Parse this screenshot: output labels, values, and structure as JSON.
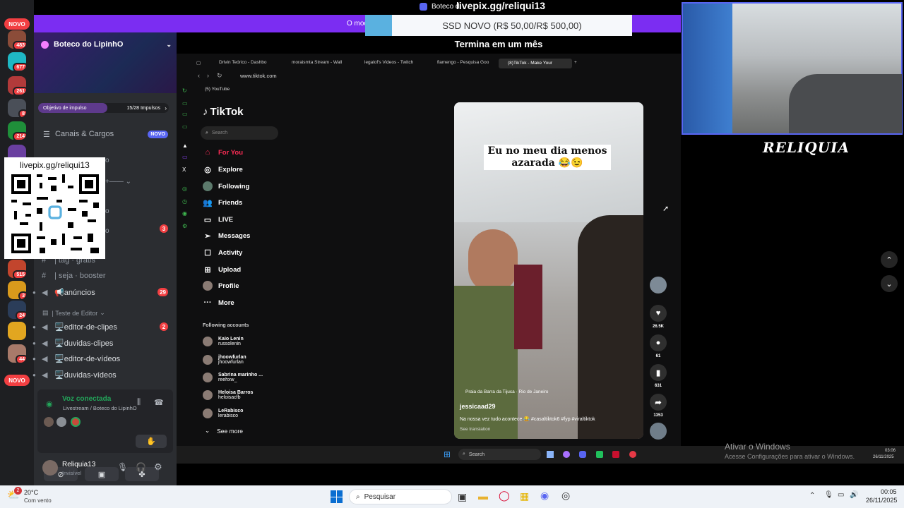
{
  "stream_title_top": "livepix.gg/reliqui13",
  "discord_overlay_title": "Boteco d",
  "promo": {
    "prefix": "O mod",
    "banner": "SSD NOVO (R$ 50,00/R$ 500,00)",
    "subtitle": "Termina em um mês"
  },
  "webcam_name": "RELIQUIA",
  "qr": {
    "label": "livepix.gg/reliqui13"
  },
  "discord": {
    "server_name": "Boteco do LipinhO",
    "boost_label": "Objetivo de impulso",
    "boost_count": "15/28 Impulsos",
    "canais_label": "Canais & Cargos",
    "canais_badge": "NOVO",
    "partial_1": "o",
    "partial_2": "o",
    "partial_3": "o",
    "badge_3": "3",
    "channels": [
      {
        "label": "| tag · grátis",
        "count": ""
      },
      {
        "label": "| seja · booster",
        "count": ""
      },
      {
        "label": "📢anúncios",
        "count": "29"
      }
    ],
    "category": "| Teste de Editor",
    "channels2": [
      {
        "label": "🖥️editor-de-clipes",
        "count": "2"
      },
      {
        "label": "🖥️duvidas-clipes",
        "count": ""
      },
      {
        "label": "🖥️editor-de-vídeos",
        "count": ""
      },
      {
        "label": "🖥️duvidas-vídeos",
        "count": ""
      }
    ],
    "voice_status": "Voz conectada",
    "voice_channel": "Livestream / Boteco do LipinhO",
    "user_name": "Reliquia13",
    "user_status": "Invisível",
    "rail": {
      "novo_top": "NOVO",
      "novo_bottom": "NOVO",
      "badges": [
        "483",
        "677",
        "261",
        "8",
        "214",
        "515",
        "3",
        "24",
        "44"
      ]
    }
  },
  "browser": {
    "tabs": [
      "Drivin Teórico - Dashbo",
      "moraismta Stream - Wall",
      "legalof's Videos - Twitch",
      "flamengo - Pesquisa Goo",
      "(8)TikTok - Make Your"
    ],
    "url": "www.tiktok.com",
    "bookmark": "(5) YouTube"
  },
  "tiktok": {
    "logo": "TikTok",
    "search_placeholder": "Search",
    "nav": [
      "For You",
      "Explore",
      "Following",
      "Friends",
      "LIVE",
      "Messages",
      "Activity",
      "Upload",
      "Profile",
      "More"
    ],
    "following_accounts_title": "Following accounts",
    "accounts": [
      {
        "name": "Kaio Lenin",
        "handle": "russolenin"
      },
      {
        "name": "jhoowfurlan",
        "handle": "jhoowfurlan"
      },
      {
        "name": "Sabrina marinho ...",
        "handle": "reehxw_"
      },
      {
        "name": "Heloisa Barros",
        "handle": "heloisacfb"
      },
      {
        "name": "LeRabisco",
        "handle": "lerabisco"
      }
    ],
    "see_more": "See more",
    "video_caption": "Eu no meu dia menos azarada 😂😉",
    "location": "Praia da Barra da Tijuca · Rio de Janeiro",
    "author": "jessicaad29",
    "description": "Na nossa vez tudo acontece 😂 #casaltiktok6 #fyp #viraltiktok",
    "see_translation": "See translation",
    "likes": "26.5K",
    "comments": "61",
    "saves": "631",
    "shares": "1353"
  },
  "inner_taskbar": {
    "search": "Search",
    "time": "03:06",
    "date": "26/11/2025"
  },
  "watermark": {
    "line1": "Ativar o Windows",
    "line2": "Acesse Configurações para ativar o Windows."
  },
  "taskbar": {
    "temp": "20°C",
    "weather": "Com vento",
    "weather_badge": "2",
    "search": "Pesquisar",
    "time": "00:05",
    "date": "26/11/2025"
  }
}
